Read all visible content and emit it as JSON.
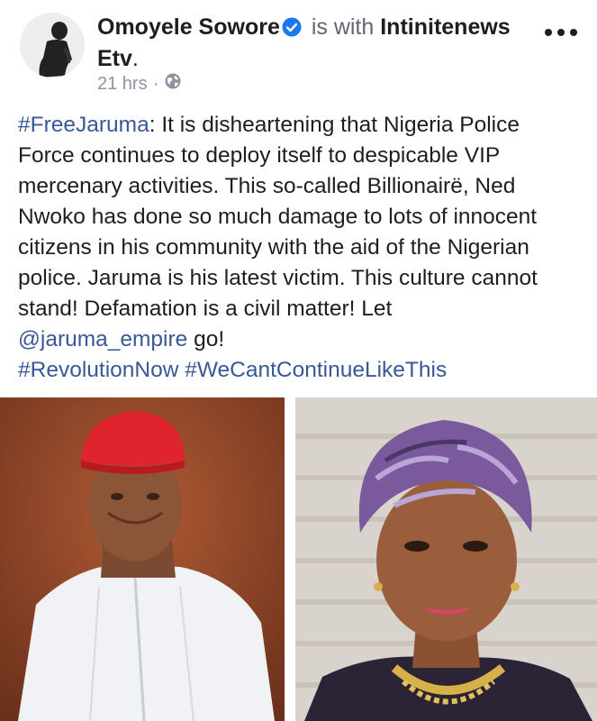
{
  "post": {
    "author": "Omoyele Sowore",
    "with_text": "is with",
    "tagged_page_line1": "Intinitenews",
    "tagged_page_line2": "Etv",
    "tagged_page_suffix": ".",
    "timestamp": "21 hrs",
    "separator": "·",
    "privacy_icon": "globe-icon",
    "verified_icon": "verified-badge-icon",
    "more_icon": "more-options-icon",
    "colors": {
      "link": "#385898",
      "verified": "#1877f2",
      "text": "#1c1e21",
      "meta": "#8d949e"
    },
    "body": {
      "hashtag_free": "#FreeJaruma",
      "line1_rest": ": It is disheartening that Nigeria Police",
      "line2": "Force continues to deploy itself to despicable VIP",
      "line3": "mercenary activities. This so-called Billionairë, Ned",
      "line4": "Nwoko has done so much damage to lots of innocent",
      "line5": "citizens in his community with the aid of the Nigerian",
      "line6": "police. Jaruma is his latest victim. This culture cannot",
      "line7": "stand! Defamation is a civil matter! Let",
      "mention": "@jaruma_empire",
      "line8_rest": " go!",
      "hashtag_revolution": "#RevolutionNow",
      "hashtag_space": " ",
      "hashtag_continue": "#WeCantContinueLikeThis"
    },
    "photos": [
      {
        "description_icon": "man-in-red-cap-photo"
      },
      {
        "description_icon": "woman-in-purple-headwrap-photo"
      }
    ]
  }
}
